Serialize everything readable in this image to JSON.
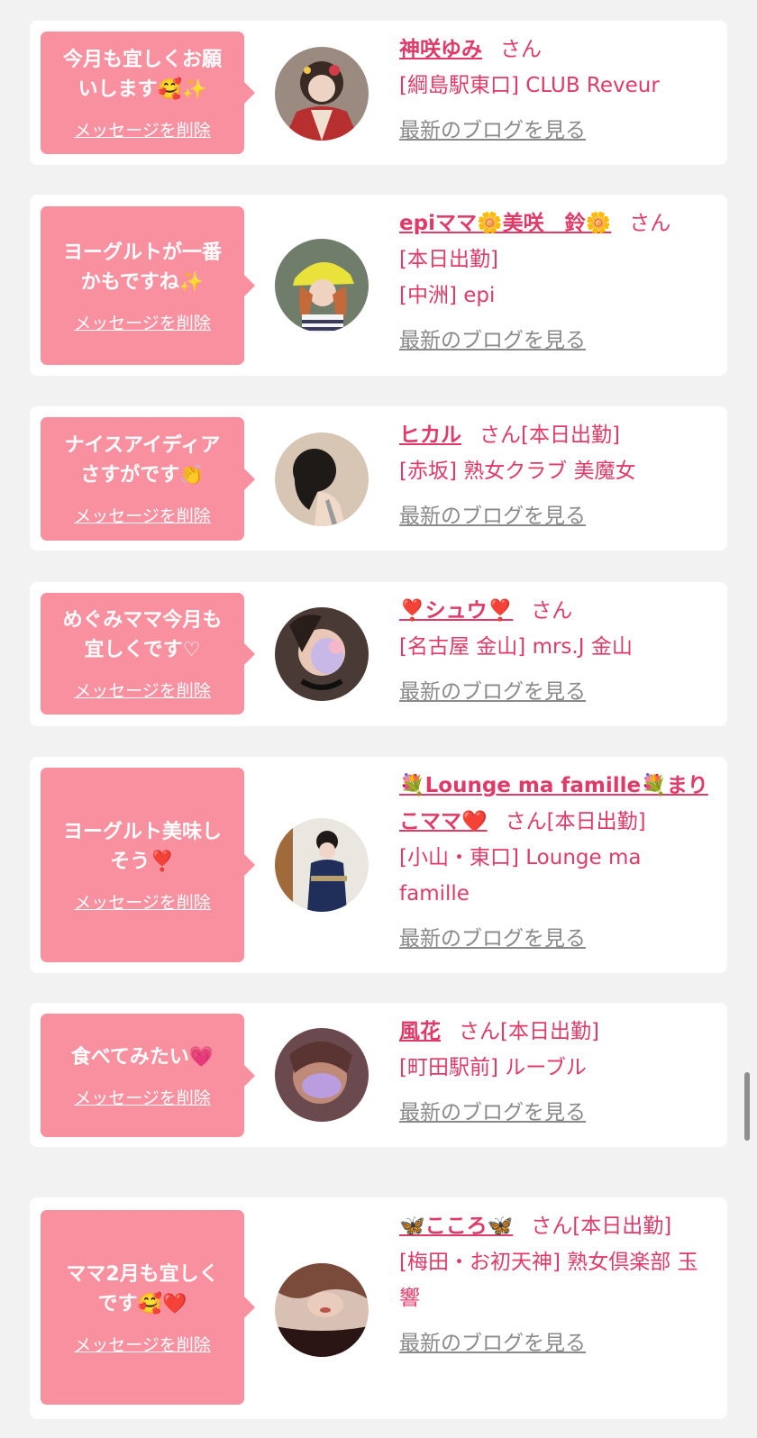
{
  "delete_label": "メッセージを削除",
  "blog_label": "最新のブログを見る",
  "colors": {
    "page_bg": "#f2f2f2",
    "bubble": "#f8909f",
    "accent": "#df3b69",
    "link_gray": "#8a8a8a"
  },
  "entries": [
    {
      "message": "今月も宜しくお願\nいします🥰✨",
      "name": "神咲ゆみ",
      "honorific": "さん",
      "status": "",
      "lines": [
        "[綱島駅東口] CLUB Reveur"
      ]
    },
    {
      "message": "ヨーグルトが一番\nかもですね✨",
      "name": "epiママ🌼美咲　鈴🌼",
      "honorific": "さん",
      "status": "",
      "lines": [
        "[本日出勤]",
        "[中洲] epi"
      ]
    },
    {
      "message": "ナイスアイディア\nさすがです👏",
      "name": "ヒカル",
      "honorific": "さん",
      "status": "[本日出勤]",
      "lines": [
        "[赤坂] 熟女クラブ 美魔女"
      ]
    },
    {
      "message": "めぐみママ今月も\n宜しくです♡",
      "name": "❣️シュウ❣️",
      "honorific": "さん",
      "status": "",
      "lines": [
        "[名古屋 金山] mrs.J 金山"
      ]
    },
    {
      "message": "ヨーグルト美味し\nそう❣️",
      "name": "💐Lounge ma famille💐まりこママ❤️",
      "honorific": "さん",
      "status": "[本日出勤]",
      "lines": [
        "[小山・東口] Lounge ma famille"
      ]
    },
    {
      "message": "食べてみたい💗",
      "name": "風花",
      "honorific": "さん",
      "status": "[本日出勤]",
      "lines": [
        "[町田駅前] ルーブル"
      ]
    },
    {
      "message": "ママ2月も宜しく\nです🥰❤️",
      "name": "🦋こころ🦋",
      "honorific": "さん",
      "status": "[本日出勤]",
      "lines": [
        "[梅田・お初天神] 熟女倶楽部 玉響"
      ]
    }
  ]
}
